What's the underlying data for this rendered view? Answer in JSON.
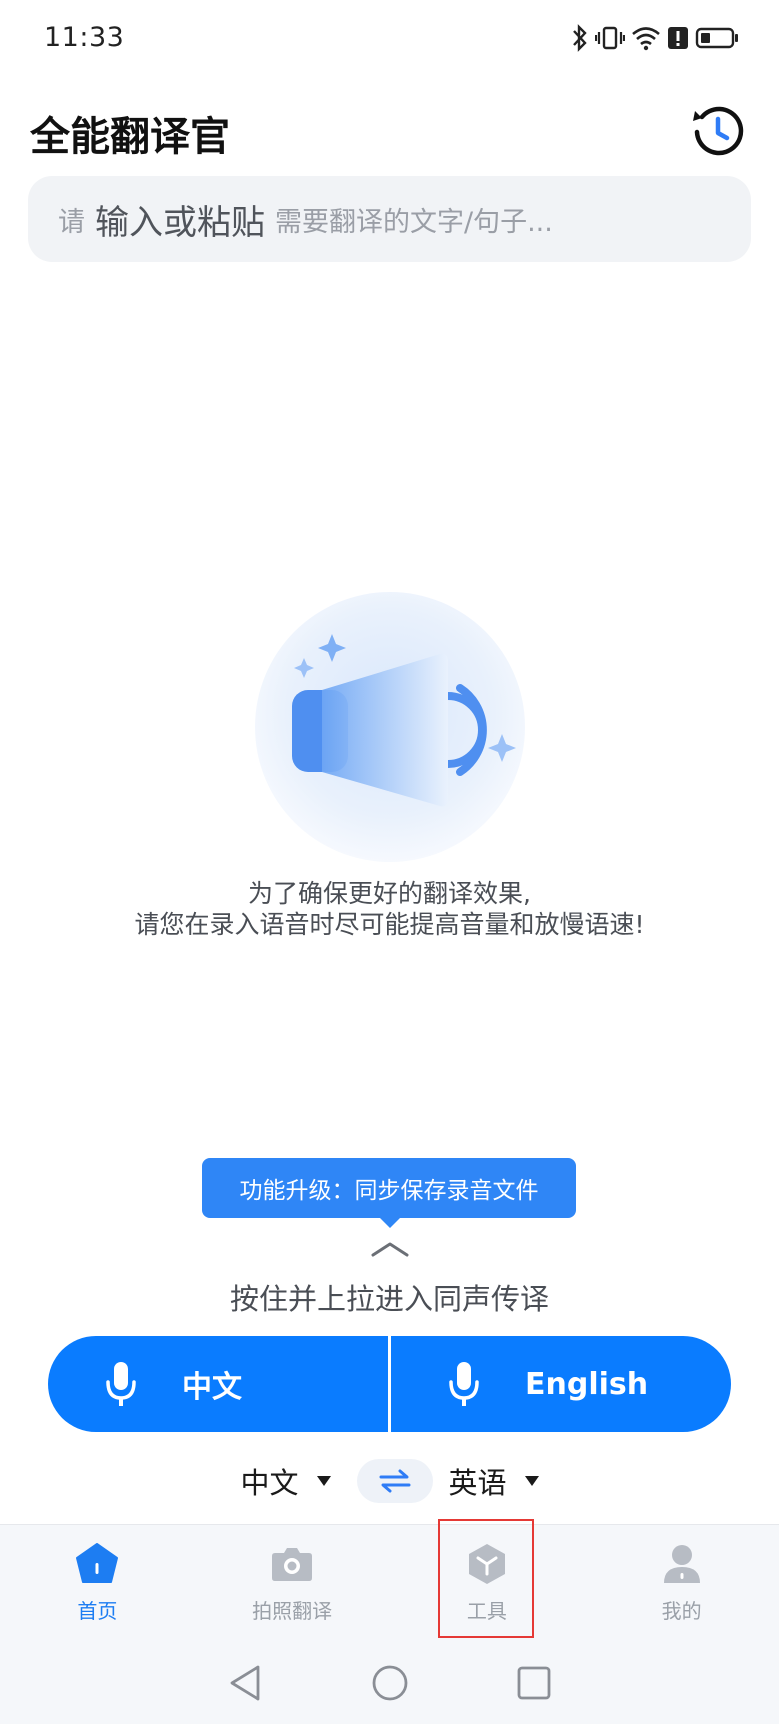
{
  "status_bar": {
    "time": "11:33"
  },
  "header": {
    "title": "全能翻译官"
  },
  "search": {
    "placeholder_part1": "请",
    "placeholder_part2": "输入或粘贴",
    "placeholder_part3": "需要翻译的文字/句子..."
  },
  "tip": {
    "line1": "为了确保更好的翻译效果,",
    "line2": "请您在录入语音时尽可能提高音量和放慢语速!"
  },
  "tooltip": {
    "text": "功能升级：同步保存录音文件"
  },
  "swipe_hint": "按住并上拉进入同声传译",
  "mic_buttons": {
    "left_label": "中文",
    "right_label": "English"
  },
  "language_selector": {
    "source": "中文",
    "target": "英语"
  },
  "bottom_nav": {
    "items": [
      {
        "label": "首页",
        "icon": "home-icon",
        "active": true
      },
      {
        "label": "拍照翻译",
        "icon": "camera-icon",
        "active": false
      },
      {
        "label": "工具",
        "icon": "box-icon",
        "active": false
      },
      {
        "label": "我的",
        "icon": "user-icon",
        "active": false
      }
    ]
  },
  "colors": {
    "primary": "#0a7cff",
    "tooltip": "#2f86f6",
    "active_nav": "#1d7df2",
    "inactive_nav": "#9aa0a8",
    "highlight": "#e53935"
  }
}
